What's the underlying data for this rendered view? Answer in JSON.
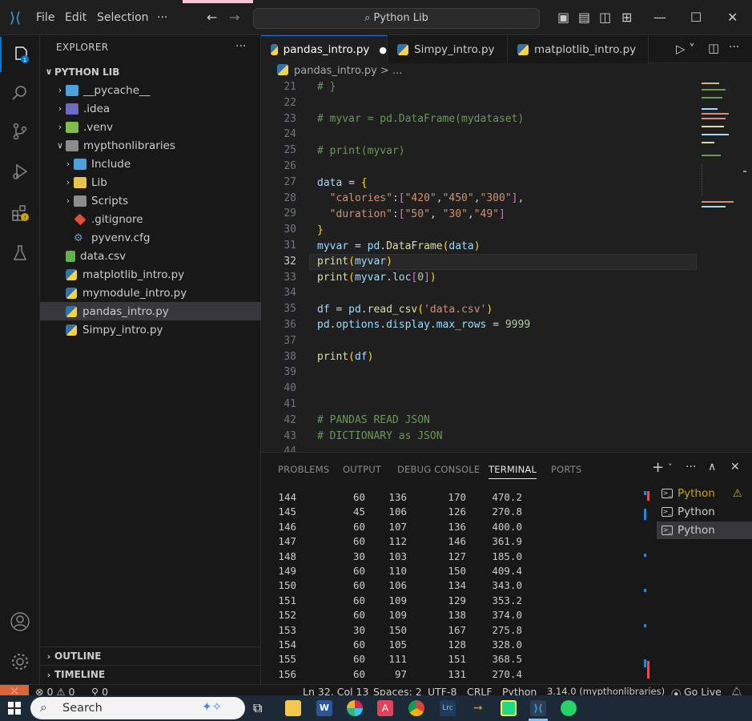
{
  "titlebar": {
    "menu": [
      "File",
      "Edit",
      "Selection",
      "···"
    ],
    "search": "Python Lib"
  },
  "explorer": {
    "header": "EXPLORER",
    "more": "···",
    "root": "PYTHON LIB",
    "items": [
      {
        "label": "__pycache__",
        "color": "#4aa3df"
      },
      {
        "label": ".idea",
        "color": "#6c6cc7"
      },
      {
        "label": ".venv",
        "color": "#7dbd4c"
      },
      {
        "label": "mypthonlibraries",
        "color": "#8c8c8c"
      },
      {
        "label": "Include",
        "color": "#4aa3df"
      },
      {
        "label": "Lib",
        "color": "#e8c34a"
      },
      {
        "label": "Scripts",
        "color": "#8c8c8c"
      },
      {
        "label": ".gitignore",
        "color": "#e04e39"
      },
      {
        "label": "pyvenv.cfg",
        "color": "#6c9bd2"
      },
      {
        "label": "data.csv",
        "color": "#5fb04e"
      },
      {
        "label": "matplotlib_intro.py",
        "color": "#3572A5"
      },
      {
        "label": "mymodule_intro.py",
        "color": "#3572A5"
      },
      {
        "label": "pandas_intro.py",
        "color": "#3572A5"
      },
      {
        "label": "Simpy_intro.py",
        "color": "#3572A5"
      }
    ],
    "outline": "OUTLINE",
    "timeline": "TIMELINE"
  },
  "tabs": [
    {
      "label": "pandas_intro.py",
      "dirty": "●"
    },
    {
      "label": "Simpy_intro.py"
    },
    {
      "label": "matplotlib_intro.py"
    }
  ],
  "breadcrumb": "pandas_intro.py > ...",
  "editor": {
    "line_numbers": [
      "21",
      "22",
      "23",
      "24",
      "25",
      "26",
      "27",
      "28",
      "29",
      "30",
      "31",
      "32",
      "33",
      "34",
      "35",
      "36",
      "37",
      "38",
      "39",
      "40",
      "41",
      "42",
      "43",
      "44"
    ],
    "lines": [
      "# }",
      "",
      "# myvar = pd.DataFrame(mydataset)",
      "",
      "# print(myvar)",
      "",
      "data = {",
      "  \"calories\":[\"420\",\"450\",\"300\"],",
      "  \"duration\":[\"50\", \"30\",\"49\"]",
      "}",
      "myvar = pd.DataFrame(data)",
      "print(myvar)",
      "print(myvar.loc[0])",
      "",
      "df = pd.read_csv('data.csv')",
      "pd.options.display.max_rows = 9999",
      "",
      "print(df)",
      "",
      "",
      "",
      "# PANDAS READ JSON",
      "# DICTIONARY as JSON",
      ""
    ]
  },
  "panel": {
    "tabs": [
      "PROBLEMS",
      "OUTPUT",
      "DEBUG CONSOLE",
      "TERMINAL",
      "PORTS"
    ],
    "active_tab": "TERMINAL",
    "rows": [
      [
        "144",
        "60",
        "136",
        "170",
        "470.2"
      ],
      [
        "145",
        "45",
        "106",
        "126",
        "270.8"
      ],
      [
        "146",
        "60",
        "107",
        "136",
        "400.0"
      ],
      [
        "147",
        "60",
        "112",
        "146",
        "361.9"
      ],
      [
        "148",
        "30",
        "103",
        "127",
        "185.0"
      ],
      [
        "149",
        "60",
        "110",
        "150",
        "409.4"
      ],
      [
        "150",
        "60",
        "106",
        "134",
        "343.0"
      ],
      [
        "151",
        "60",
        "109",
        "129",
        "353.2"
      ],
      [
        "152",
        "60",
        "109",
        "138",
        "374.0"
      ],
      [
        "153",
        "30",
        "150",
        "167",
        "275.8"
      ],
      [
        "154",
        "60",
        "105",
        "128",
        "328.0"
      ],
      [
        "155",
        "60",
        "111",
        "151",
        "368.5"
      ],
      [
        "156",
        "60",
        "97",
        "131",
        "270.4"
      ]
    ],
    "terminals": [
      "Python",
      "Python",
      "Python"
    ]
  },
  "statusbar": {
    "errors": "⊗ 0 ⚠ 0",
    "ports": "⚲ 0",
    "position": "Ln 32, Col 13",
    "spaces": "Spaces: 2",
    "encoding": "UTF-8",
    "eol": "CRLF",
    "language": "Python",
    "interpreter": "3.14.0 (mypthonlibraries)",
    "golive": "Go Live"
  },
  "taskbar": {
    "search": "Search"
  }
}
